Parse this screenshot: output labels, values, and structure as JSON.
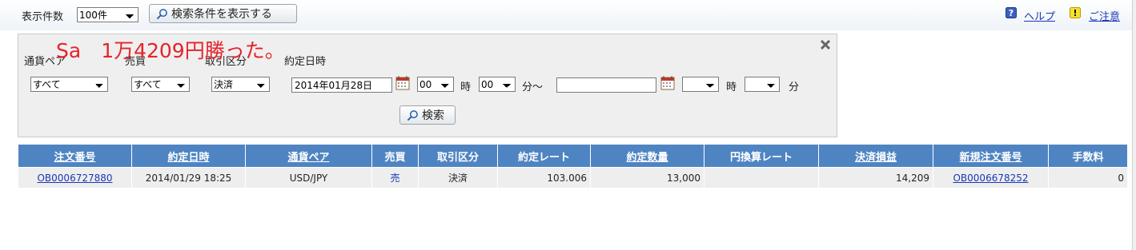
{
  "toolbar": {
    "display_count_label": "表示件数",
    "display_count_value": "100件",
    "show_conditions_button": "検索条件を表示する",
    "help_link": "ヘルプ",
    "caution_link": "ご注意"
  },
  "overlay_text": "Sa　1万4209円勝った。",
  "search": {
    "pair_label": "通貨ペア",
    "pair_value": "すべて",
    "side_label": "売買",
    "side_value": "すべて",
    "type_label": "取引区分",
    "type_value": "決済",
    "date_label": "約定日時",
    "from_date": "2014年01月28日",
    "from_hour": "00",
    "hour_unit": "時",
    "from_min": "00",
    "min_unit_tilde": "分～",
    "to_date": "",
    "to_hour": "",
    "to_min": "",
    "min_unit": "分",
    "search_button": "検索"
  },
  "table": {
    "headers": [
      {
        "label": "注文番号",
        "link": true
      },
      {
        "label": "約定日時",
        "link": true
      },
      {
        "label": "通貨ペア",
        "link": true
      },
      {
        "label": "売買",
        "link": false
      },
      {
        "label": "取引区分",
        "link": false
      },
      {
        "label": "約定レート",
        "link": false
      },
      {
        "label": "約定数量",
        "link": true
      },
      {
        "label": "円換算レート",
        "link": false
      },
      {
        "label": "決済損益",
        "link": true
      },
      {
        "label": "新規注文番号",
        "link": true
      },
      {
        "label": "手数料",
        "link": false
      }
    ],
    "rows": [
      {
        "order_no": "OB0006727880",
        "datetime": "2014/01/29 18:25",
        "pair": "USD/JPY",
        "side": "売",
        "type": "決済",
        "rate": "103.006",
        "quantity": "13,000",
        "yen_rate": "",
        "pl": "14,209",
        "new_order_no": "OB0006678252",
        "fee": "0"
      }
    ]
  },
  "colors": {
    "header_blue": "#4f84c2",
    "link_blue": "#1a37b5",
    "overlay_red": "#e6232a",
    "panel_gray": "#efefef"
  }
}
